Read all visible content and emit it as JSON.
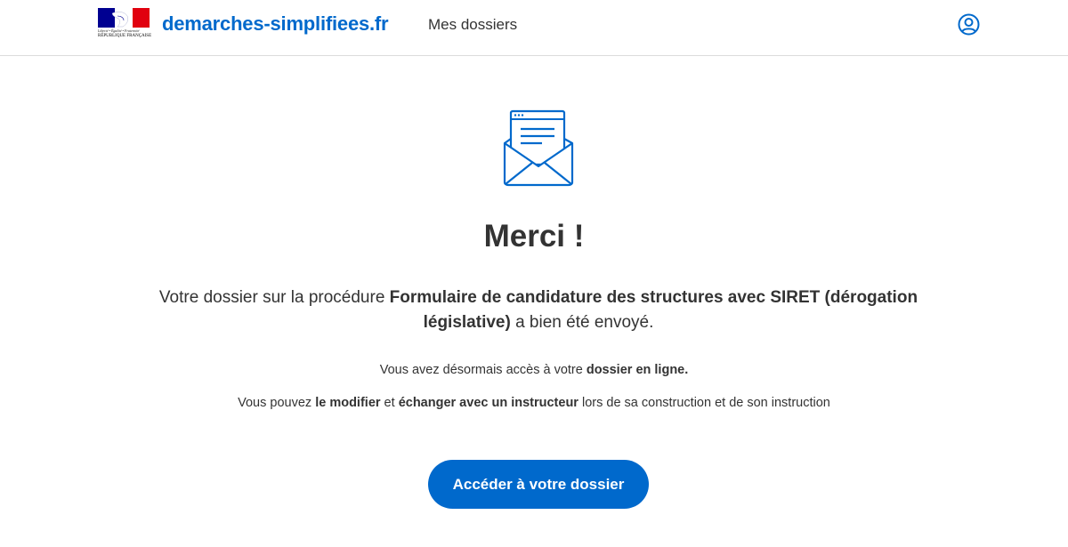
{
  "header": {
    "gov": {
      "motto": "Liberté • Égalité • Fraternité",
      "name": "RÉPUBLIQUE FRANÇAISE"
    },
    "brand": "demarches-simplifiees.fr",
    "nav_link": "Mes dossiers",
    "user_icon": "user-circle-icon"
  },
  "main": {
    "illustration": "envelope-letter-icon",
    "title": "Merci !",
    "lead": {
      "prefix": "Votre dossier sur la procédure ",
      "procedure": "Formulaire de candidature des structures avec SIRET (dérogation législative)",
      "suffix": " a bien été envoyé."
    },
    "info1": {
      "prefix": "Vous avez désormais accès à votre ",
      "bold": "dossier en ligne."
    },
    "info2": {
      "prefix": "Vous pouvez ",
      "bold1": "le modifier",
      "middle": " et ",
      "bold2": "échanger avec un instructeur",
      "suffix": " lors de sa construction et de son instruction"
    },
    "cta_label": "Accéder à votre dossier"
  },
  "colors": {
    "accent": "#0069cc",
    "text": "#333333",
    "flag_blue": "#000091",
    "flag_red": "#e1000f"
  }
}
